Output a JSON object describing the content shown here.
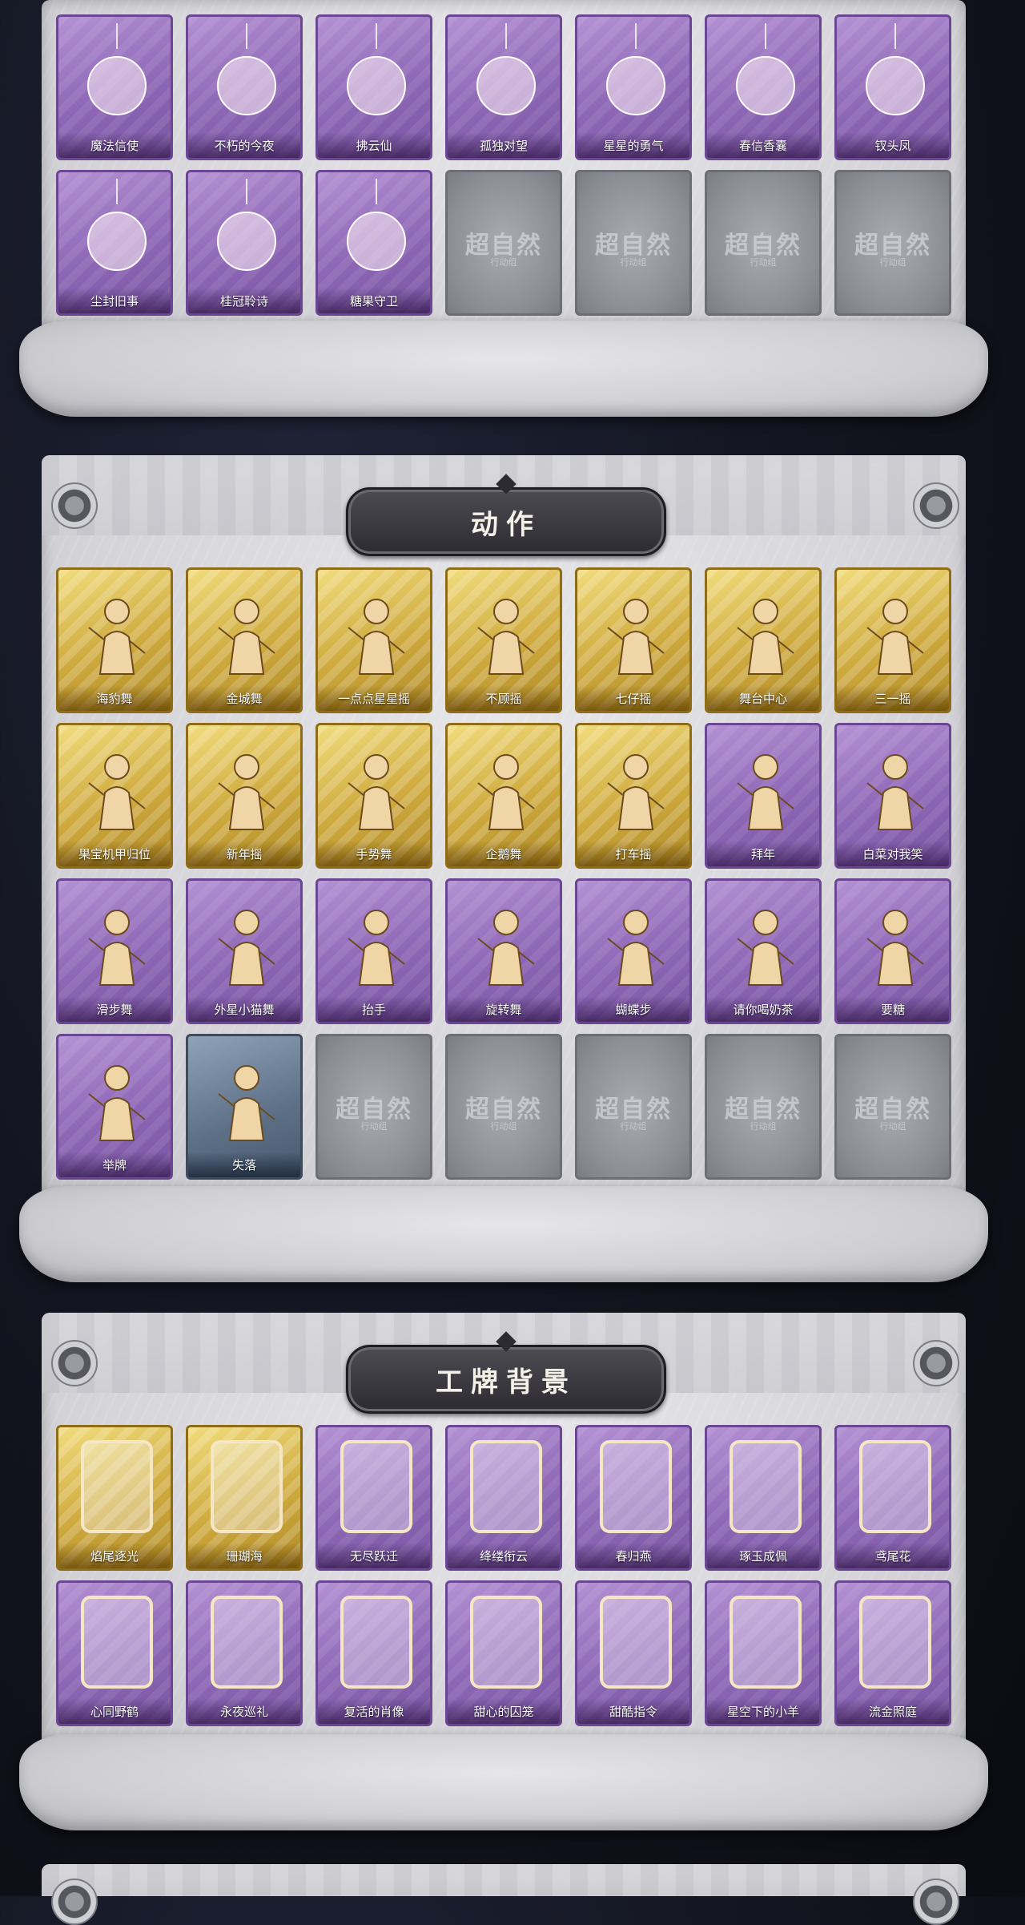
{
  "colors": {
    "purple_card": "#8e67b6",
    "gold_card": "#cfaa3e",
    "blue_card": "#5d6f86",
    "empty_card": "#8b8e94",
    "title_plate": "#2c2b31"
  },
  "pendants": {
    "items": [
      {
        "label": "魔法信使",
        "rarity": "purple",
        "icon": "elephant-mascot-icon"
      },
      {
        "label": "不朽的今夜",
        "rarity": "purple",
        "icon": "pink-cat-icon"
      },
      {
        "label": "拂云仙",
        "rarity": "purple",
        "icon": "immortal-figure-icon"
      },
      {
        "label": "孤独对望",
        "rarity": "purple",
        "icon": "silver-figure-icon"
      },
      {
        "label": "星星的勇气",
        "rarity": "purple",
        "icon": "planet-figure-icon"
      },
      {
        "label": "春信香囊",
        "rarity": "purple",
        "icon": "sachet-icon"
      },
      {
        "label": "钗头凤",
        "rarity": "purple",
        "icon": "phoenix-crown-icon"
      },
      {
        "label": "尘封旧事",
        "rarity": "purple",
        "icon": "dark-hair-figure-icon"
      },
      {
        "label": "桂冠聆诗",
        "rarity": "purple",
        "icon": "laurel-figure-icon"
      },
      {
        "label": "糖果守卫",
        "rarity": "purple",
        "icon": "pumpkin-guard-icon"
      },
      {
        "label": "",
        "rarity": "empty",
        "watermark": "超自然",
        "watermark_sub": "行动组"
      },
      {
        "label": "",
        "rarity": "empty",
        "watermark": "超自然",
        "watermark_sub": "行动组"
      },
      {
        "label": "",
        "rarity": "empty",
        "watermark": "超自然",
        "watermark_sub": "行动组"
      },
      {
        "label": "",
        "rarity": "empty",
        "watermark": "超自然",
        "watermark_sub": "行动组"
      }
    ]
  },
  "actions": {
    "title": "动作",
    "items": [
      {
        "label": "海豹舞",
        "rarity": "gold"
      },
      {
        "label": "金城舞",
        "rarity": "gold"
      },
      {
        "label": "一点点星星摇",
        "rarity": "gold"
      },
      {
        "label": "不顾摇",
        "rarity": "gold"
      },
      {
        "label": "七仔摇",
        "rarity": "gold"
      },
      {
        "label": "舞台中心",
        "rarity": "gold"
      },
      {
        "label": "三一摇",
        "rarity": "gold"
      },
      {
        "label": "果宝机甲归位",
        "rarity": "gold"
      },
      {
        "label": "新年摇",
        "rarity": "gold"
      },
      {
        "label": "手势舞",
        "rarity": "gold"
      },
      {
        "label": "企鹅舞",
        "rarity": "gold"
      },
      {
        "label": "打车摇",
        "rarity": "gold"
      },
      {
        "label": "拜年",
        "rarity": "purple"
      },
      {
        "label": "白菜对我笑",
        "rarity": "purple"
      },
      {
        "label": "滑步舞",
        "rarity": "purple"
      },
      {
        "label": "外星小猫舞",
        "rarity": "purple"
      },
      {
        "label": "抬手",
        "rarity": "purple"
      },
      {
        "label": "旋转舞",
        "rarity": "purple"
      },
      {
        "label": "蝴蝶步",
        "rarity": "purple"
      },
      {
        "label": "请你喝奶茶",
        "rarity": "purple"
      },
      {
        "label": "要糖",
        "rarity": "purple"
      },
      {
        "label": "举牌",
        "rarity": "purple"
      },
      {
        "label": "失落",
        "rarity": "blue"
      },
      {
        "label": "",
        "rarity": "empty",
        "watermark": "超自然",
        "watermark_sub": "行动组"
      },
      {
        "label": "",
        "rarity": "empty",
        "watermark": "超自然",
        "watermark_sub": "行动组"
      },
      {
        "label": "",
        "rarity": "empty",
        "watermark": "超自然",
        "watermark_sub": "行动组"
      },
      {
        "label": "",
        "rarity": "empty",
        "watermark": "超自然",
        "watermark_sub": "行动组"
      },
      {
        "label": "",
        "rarity": "empty",
        "watermark": "超自然",
        "watermark_sub": "行动组"
      }
    ]
  },
  "badge_backgrounds": {
    "title": "工牌背景",
    "items": [
      {
        "label": "焰尾逐光",
        "rarity": "gold"
      },
      {
        "label": "珊瑚海",
        "rarity": "gold"
      },
      {
        "label": "无尽跃迁",
        "rarity": "purple"
      },
      {
        "label": "绛缕衔云",
        "rarity": "purple"
      },
      {
        "label": "春归燕",
        "rarity": "purple"
      },
      {
        "label": "琢玉成佩",
        "rarity": "purple"
      },
      {
        "label": "鸢尾花",
        "rarity": "purple"
      },
      {
        "label": "心同野鹤",
        "rarity": "purple"
      },
      {
        "label": "永夜巡礼",
        "rarity": "purple"
      },
      {
        "label": "复活的肖像",
        "rarity": "purple"
      },
      {
        "label": "甜心的囚笼",
        "rarity": "purple"
      },
      {
        "label": "甜酷指令",
        "rarity": "purple"
      },
      {
        "label": "星空下的小羊",
        "rarity": "purple"
      },
      {
        "label": "流金照庭",
        "rarity": "purple"
      }
    ]
  }
}
